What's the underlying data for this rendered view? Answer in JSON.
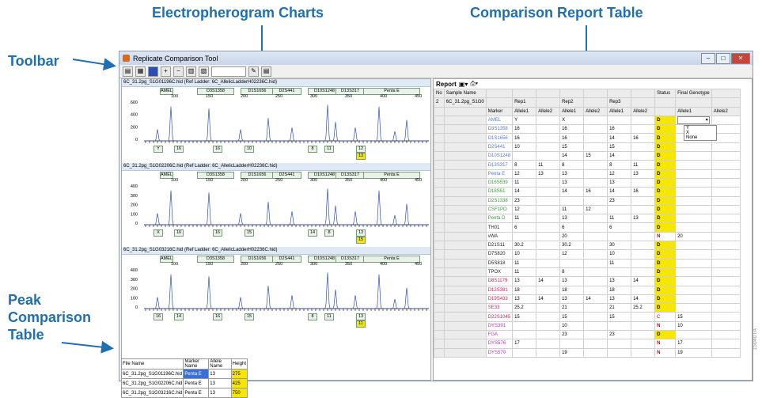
{
  "callouts": {
    "charts": "Electropherogram Charts",
    "report": "Comparison Report Table",
    "toolbar": "Toolbar",
    "peak": [
      "Peak",
      "Comparison",
      "Table"
    ]
  },
  "window": {
    "title": "Replicate Comparison Tool"
  },
  "report_toolbar": {
    "label": "Report"
  },
  "panels": [
    {
      "file": "6C_31.2pg_S1G01196C.hid",
      "ladder": "(Ref Ladder: 6C_AllelicLadderH02236C.hid)",
      "y_ticks": [
        "600",
        "400",
        "200",
        "0"
      ],
      "alleles": [
        "Y",
        "16",
        "16",
        "10",
        "8",
        "11",
        "12"
      ],
      "highlight": "13"
    },
    {
      "file": "6C_31.2pg_S1G02206C.hid",
      "ladder": "(Ref Ladder: 6C_AllelicLadderH02236C.hid)",
      "y_ticks": [
        "400",
        "300",
        "200",
        "100",
        "0"
      ],
      "alleles": [
        "X",
        "16",
        "16",
        "15",
        "14",
        "8",
        "13"
      ],
      "highlight": "15"
    },
    {
      "file": "6C_31.2pg_S1G03216C.hid",
      "ladder": "(Ref Ladder: 6C_AllelicLadderH02236C.hid)",
      "y_ticks": [
        "400",
        "300",
        "200",
        "100",
        "0"
      ],
      "alleles": [
        "16",
        "14",
        "16",
        "15",
        "8",
        "11",
        "13"
      ],
      "highlight": "11"
    }
  ],
  "marker_bar": [
    "AMEL",
    "D3S1358",
    "D1S1656",
    "D2S441",
    "D10S1248",
    "D13S317",
    "Penta E"
  ],
  "scale": [
    "100",
    "150",
    "200",
    "250",
    "300",
    "350",
    "400",
    "450",
    "500"
  ],
  "peak_table": {
    "headers": [
      "File Name",
      "Marker Name",
      "Allele Name",
      "Height"
    ],
    "rows": [
      [
        "6C_31.2pg_S1G01196C.hid",
        "Penta E",
        "13",
        "275"
      ],
      [
        "6C_31.2pg_S1G02206C.hid",
        "Penta E",
        "13",
        "425"
      ],
      [
        "6C_31.2pg_S1G03216C.hid",
        "Penta E",
        "13",
        "750"
      ]
    ]
  },
  "report": {
    "head1": [
      "No",
      "Sample Name",
      "",
      "",
      "",
      "",
      "",
      "",
      "",
      "Status",
      "Final Genotype",
      ""
    ],
    "head2": [
      "2",
      "6C_31.2pg_S1G0",
      "",
      "Rep1",
      "",
      "Rep2",
      "",
      "Rep3",
      "",
      "",
      "",
      ""
    ],
    "head3": [
      "",
      "",
      "Marker",
      "Allele1",
      "Allele2",
      "Allele1",
      "Allele2",
      "Allele1",
      "Allele2",
      "",
      "Allele1",
      "Allele2"
    ],
    "rows": [
      [
        "AMEL",
        "blue",
        "Y",
        "",
        "X",
        "",
        "",
        "",
        "D",
        "",
        ""
      ],
      [
        "D3S1358",
        "blue",
        "16",
        "",
        "16",
        "",
        "16",
        "",
        "D",
        "",
        ""
      ],
      [
        "D1S1656",
        "blue",
        "16",
        "",
        "16",
        "",
        "14",
        "16",
        "D",
        "",
        ""
      ],
      [
        "D2S441",
        "blue",
        "10",
        "",
        "15",
        "",
        "15",
        "",
        "D",
        "",
        ""
      ],
      [
        "D10S1248",
        "blue",
        "",
        "",
        "14",
        "15",
        "14",
        "",
        "D",
        "",
        ""
      ],
      [
        "D13S317",
        "blue",
        "8",
        "11",
        "8",
        "",
        "8",
        "11",
        "D",
        "",
        ""
      ],
      [
        "Penta E",
        "blue",
        "12",
        "13",
        "13",
        "",
        "12",
        "13",
        "D",
        "",
        ""
      ],
      [
        "D16S539",
        "green",
        "11",
        "",
        "13",
        "",
        "13",
        "",
        "D",
        "",
        ""
      ],
      [
        "D18S51",
        "green",
        "14",
        "",
        "14",
        "16",
        "14",
        "16",
        "D",
        "",
        ""
      ],
      [
        "D2S1338",
        "green",
        "23",
        "",
        "",
        "",
        "23",
        "",
        "D",
        "",
        ""
      ],
      [
        "CSF1PO",
        "green",
        "12",
        "",
        "11",
        "12",
        "",
        "",
        "D",
        "",
        ""
      ],
      [
        "Penta D",
        "green",
        "11",
        "",
        "13",
        "",
        "11",
        "13",
        "D",
        "",
        ""
      ],
      [
        "TH01",
        "black",
        "6",
        "",
        "6",
        "",
        "6",
        "",
        "D",
        "",
        ""
      ],
      [
        "vWA",
        "black",
        "",
        "",
        "20",
        "",
        "",
        "",
        "N",
        "20",
        ""
      ],
      [
        "D21S11",
        "black",
        "30.2",
        "",
        "30.2",
        "",
        "30",
        "",
        "D",
        "",
        ""
      ],
      [
        "D7S820",
        "black",
        "10",
        "",
        "12",
        "",
        "10",
        "",
        "D",
        "",
        ""
      ],
      [
        "D5S818",
        "black",
        "11",
        "",
        "",
        "",
        "11",
        "",
        "D",
        "",
        ""
      ],
      [
        "TPOX",
        "black",
        "11",
        "",
        "8",
        "",
        "",
        "",
        "D",
        "",
        ""
      ],
      [
        "D8S1179",
        "red",
        "13",
        "14",
        "13",
        "",
        "13",
        "14",
        "D",
        "",
        ""
      ],
      [
        "D12S391",
        "red",
        "18",
        "",
        "18",
        "",
        "18",
        "",
        "D",
        "",
        ""
      ],
      [
        "D19S433",
        "red",
        "13",
        "14",
        "13",
        "14",
        "13",
        "14",
        "D",
        "",
        ""
      ],
      [
        "SE33",
        "red",
        "25.2",
        "",
        "21",
        "",
        "21",
        "25.2",
        "D",
        "",
        ""
      ],
      [
        "D22S1045",
        "red",
        "15",
        "",
        "15",
        "",
        "15",
        "",
        "C",
        "15",
        ""
      ],
      [
        "DYS391",
        "magenta",
        "",
        "",
        "10",
        "",
        "",
        "",
        "N",
        "10",
        ""
      ],
      [
        "FGA",
        "magenta",
        "",
        "",
        "23",
        "",
        "23",
        "",
        "D",
        "",
        ""
      ],
      [
        "DYS576",
        "magenta",
        "17",
        "",
        "",
        "",
        "",
        "",
        "N",
        "17",
        ""
      ],
      [
        "DYS570",
        "magenta",
        "",
        "",
        "19",
        "",
        "",
        "",
        "N",
        "19",
        ""
      ]
    ],
    "dropdown": [
      "Y",
      "X",
      "None"
    ]
  },
  "stamp": "15040TA"
}
